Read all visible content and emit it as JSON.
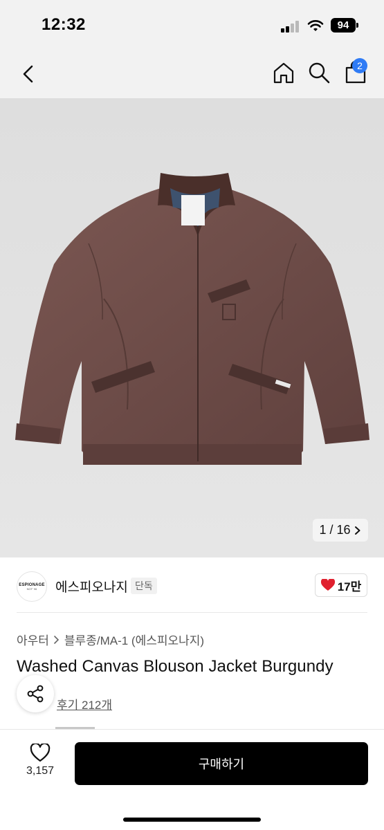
{
  "status_bar": {
    "time": "12:32",
    "battery": "94"
  },
  "header": {
    "back_icon": "chevron-left-icon",
    "home_icon": "home-icon",
    "search_icon": "search-icon",
    "bag_icon": "shopping-bag-icon",
    "bag_badge": "2",
    "accent_color": "#2f7bf5"
  },
  "gallery": {
    "counter": "1 / 16",
    "product_color": "#6f4d49"
  },
  "brand": {
    "logo_line1": "ESPIONAGE",
    "logo_line2": "NOT' 96",
    "name": "에스피오나지",
    "badge": "단독",
    "likes": "17만",
    "like_color": "#e0202e"
  },
  "product": {
    "breadcrumb_1": "아우터",
    "breadcrumb_2": "블루종/MA-1 (에스피오나지)",
    "title": "Washed Canvas Blouson Jacket Burgundy",
    "review_link": "후기 212개"
  },
  "bottom_bar": {
    "wish_count": "3,157",
    "buy_label": "구매하기"
  }
}
